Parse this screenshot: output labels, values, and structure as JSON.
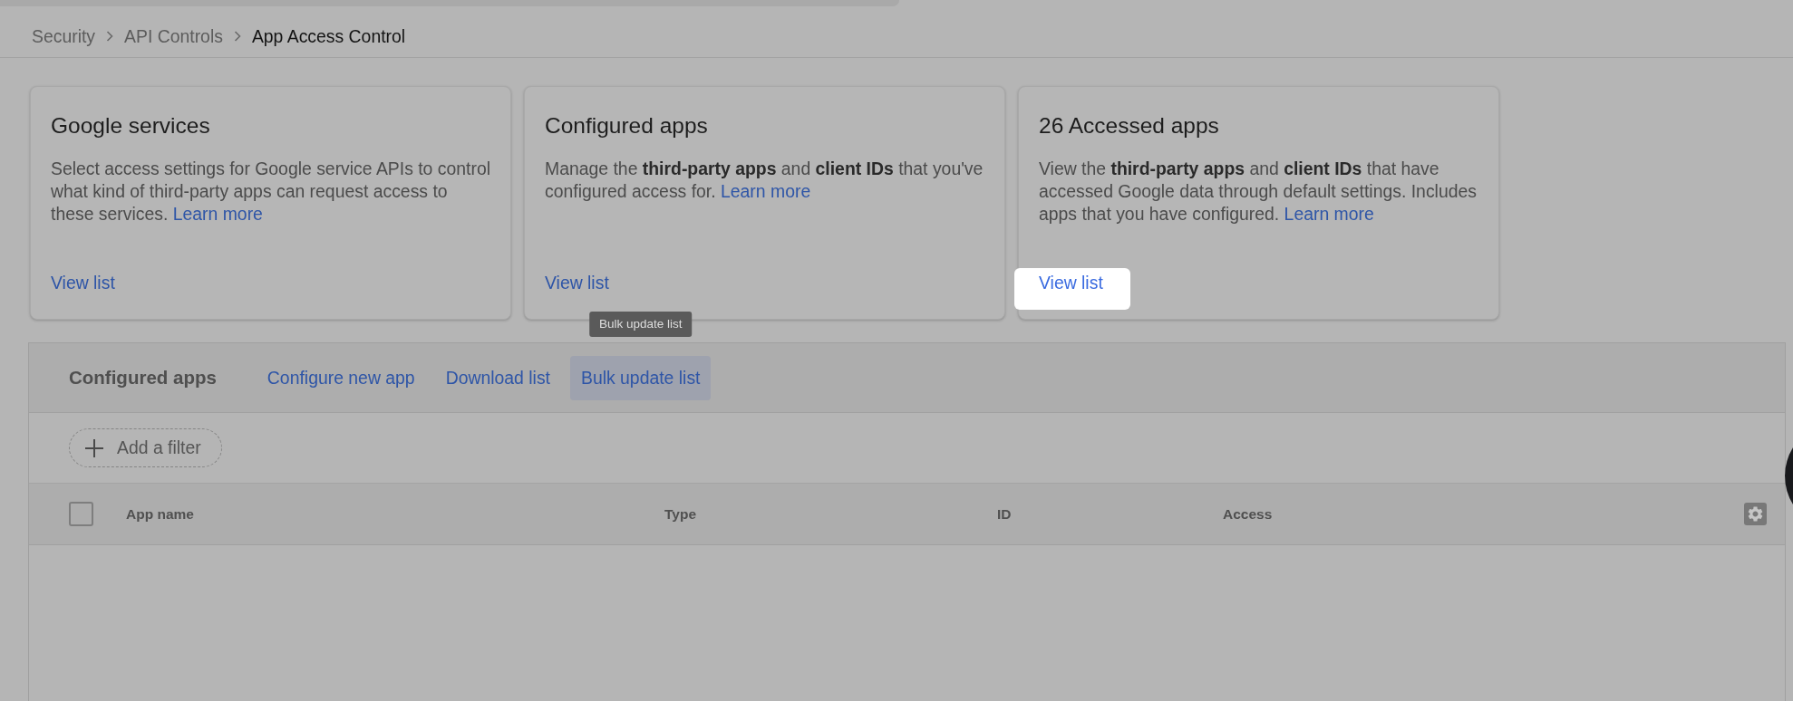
{
  "breadcrumb": [
    {
      "label": "Security",
      "current": false
    },
    {
      "label": "API Controls",
      "current": false
    },
    {
      "label": "App Access Control",
      "current": true
    }
  ],
  "cards": [
    {
      "title": "Google services",
      "description": "Select access settings for Google service APIs to control what kind of third-party apps can request access to these services.",
      "link": "Learn more",
      "action": "View list",
      "highlighted": false
    },
    {
      "title": "Configured apps",
      "description": "Manage the **third-party apps** and **client IDs** that you've configured access for.",
      "link": "Learn more",
      "action": "View list",
      "highlighted": false
    },
    {
      "title": "26 Accessed apps",
      "description": "View the **third-party apps** and **client IDs** that have accessed Google data through default settings. Includes apps that you have configured.",
      "link": "Learn more",
      "action": "View list",
      "highlighted": true
    }
  ],
  "panel": {
    "title": "Configured apps",
    "actions": [
      {
        "label": "Configure new app",
        "hovered": false
      },
      {
        "label": "Download list",
        "hovered": false
      },
      {
        "label": "Bulk update list",
        "hovered": true,
        "tooltip": "Bulk update list"
      }
    ],
    "filter": {
      "label": "Add a filter"
    },
    "table": {
      "select_all": {
        "checked": false
      },
      "columns": [
        "App name",
        "Type",
        "ID",
        "Access"
      ]
    }
  }
}
